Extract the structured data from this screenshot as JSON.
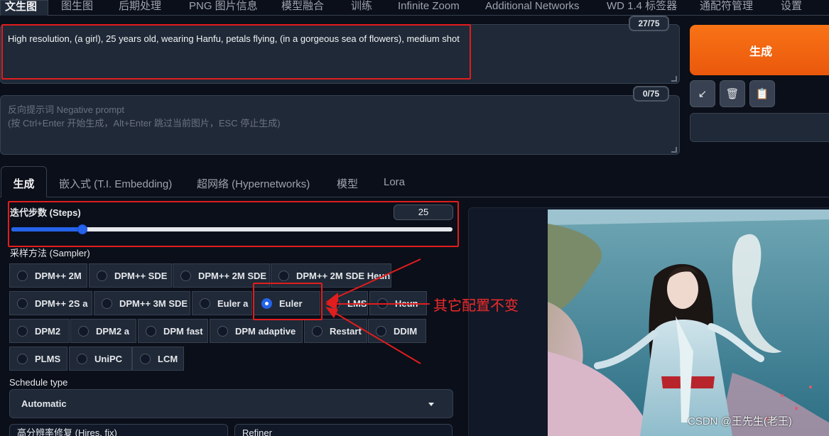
{
  "top_tabs": [
    {
      "label": "文生图",
      "active": true
    },
    {
      "label": "图生图"
    },
    {
      "label": "后期处理"
    },
    {
      "label": "PNG 图片信息"
    },
    {
      "label": "模型融合"
    },
    {
      "label": "训练"
    },
    {
      "label": "Infinite Zoom"
    },
    {
      "label": "Additional Networks"
    },
    {
      "label": "WD 1.4 标签器"
    },
    {
      "label": "通配符管理"
    },
    {
      "label": "设置"
    }
  ],
  "prompt": {
    "value": "High resolution, (a girl), 25 years old, wearing Hanfu, petals flying, (in a gorgeous sea of flowers), medium shot",
    "token_count": "27/75"
  },
  "negative_prompt": {
    "placeholder_line1": "反向提示词 Negative prompt",
    "placeholder_line2": "(按 Ctrl+Enter 开始生成，Alt+Enter 跳过当前图片，ESC 停止生成)",
    "token_count": "0/75"
  },
  "generate_button": "生成",
  "tool_icons": [
    "arrow-down-left-icon",
    "trash-icon",
    "clipboard-icon"
  ],
  "tool_glyphs": [
    "↙",
    "🗑",
    "📋"
  ],
  "sub_tabs": [
    {
      "label": "生成",
      "active": true
    },
    {
      "label": "嵌入式 (T.I. Embedding)"
    },
    {
      "label": "超网络 (Hypernetworks)"
    },
    {
      "label": "模型"
    },
    {
      "label": "Lora"
    }
  ],
  "steps": {
    "label": "迭代步数 (Steps)",
    "value": "25",
    "min": 1,
    "max": 150
  },
  "sampler": {
    "label": "采样方法 (Sampler)",
    "selected": "Euler",
    "options": [
      "DPM++ 2M",
      "DPM++ SDE",
      "DPM++ 2M SDE",
      "DPM++ 2M SDE Heun",
      "DPM++ 2S a",
      "DPM++ 3M SDE",
      "Euler a",
      "Euler",
      "LMS",
      "Heun",
      "DPM2",
      "DPM2 a",
      "DPM fast",
      "DPM adaptive",
      "Restart",
      "DDIM",
      "PLMS",
      "UniPC",
      "LCM"
    ]
  },
  "schedule": {
    "label": "Schedule type",
    "value": "Automatic"
  },
  "bottom_accordions": [
    "高分辨率修复 (Hires. fix)",
    "Refiner"
  ],
  "annotation": "其它配置不变",
  "watermark": "CSDN @王先生(老王)",
  "colors": {
    "accent": "#2563eb",
    "generate": "#ea580c",
    "highlight": "#e11d1d"
  }
}
